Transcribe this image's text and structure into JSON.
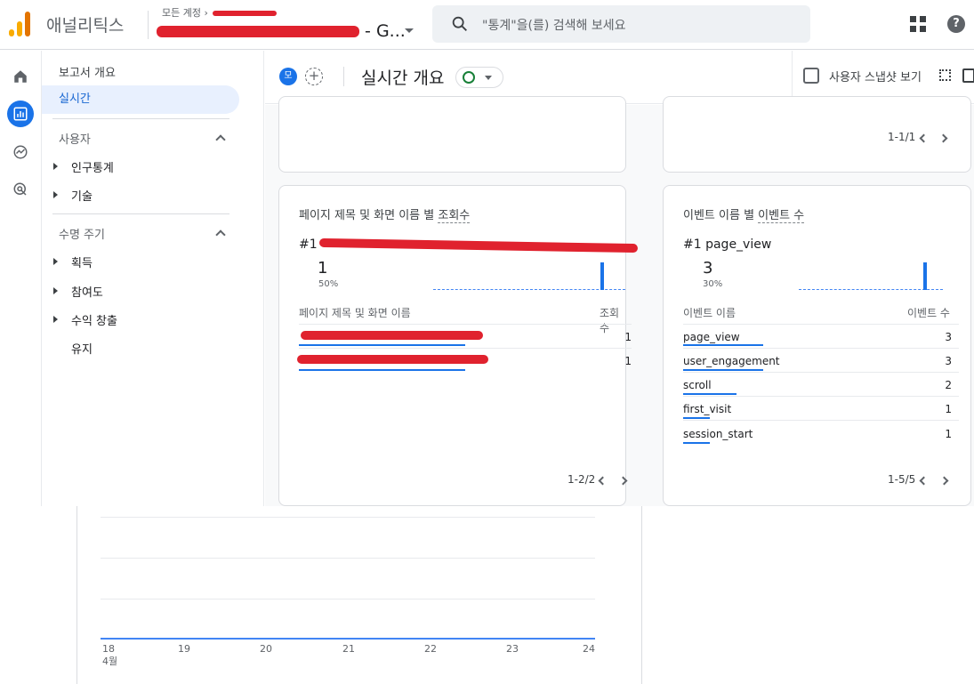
{
  "app": {
    "name": "애널리틱스",
    "breadcrumb": "모든 계정",
    "property_suffix": "- G...",
    "search_placeholder": "\"통계\"을(를) 검색해 보세요"
  },
  "sidebar": {
    "overview": "보고서 개요",
    "realtime": "실시간",
    "sections": [
      {
        "title": "사용자",
        "items": [
          "인구통계",
          "기술"
        ]
      },
      {
        "title": "수명 주기",
        "items": [
          "획득",
          "참여도",
          "수익 창출",
          "유지"
        ]
      }
    ]
  },
  "header": {
    "chip_label": "모",
    "plus_label": "+",
    "title": "실시간 개요",
    "snapshot_label": "사용자 스냅샷 보기"
  },
  "top_cards": {
    "right_pager": "1-1/1"
  },
  "page_card": {
    "title_prefix": "페이지 제목 및 화면 이름 별",
    "title_metric": "조회수",
    "rank": "#1",
    "top_value": "1",
    "top_pct": "50%",
    "col_dimension": "페이지 제목 및 화면 이름",
    "col_metric": "조회수",
    "rows": [
      {
        "value": "1",
        "share": 0.5
      },
      {
        "value": "1",
        "share": 0.5
      }
    ],
    "pager": "1-2/2"
  },
  "event_card": {
    "title_prefix": "이벤트 이름 별",
    "title_metric": "이벤트 수",
    "rank": "#1",
    "top_name": "page_view",
    "top_value": "3",
    "top_pct": "30%",
    "col_dimension": "이벤트 이름",
    "col_metric": "이벤트 수",
    "rows": [
      {
        "name": "page_view",
        "value": "3",
        "share": 0.3
      },
      {
        "name": "user_engagement",
        "value": "3",
        "share": 0.3
      },
      {
        "name": "scroll",
        "value": "2",
        "share": 0.2
      },
      {
        "name": "first_visit",
        "value": "1",
        "share": 0.1
      },
      {
        "name": "session_start",
        "value": "1",
        "share": 0.1
      }
    ],
    "pager": "1-5/5"
  },
  "bottom_chart": {
    "x_ticks": [
      "18",
      "19",
      "20",
      "21",
      "22",
      "23",
      "24"
    ],
    "x_month": "4월"
  },
  "colors": {
    "accent": "#1a73e8",
    "redaction": "#e0222e"
  }
}
